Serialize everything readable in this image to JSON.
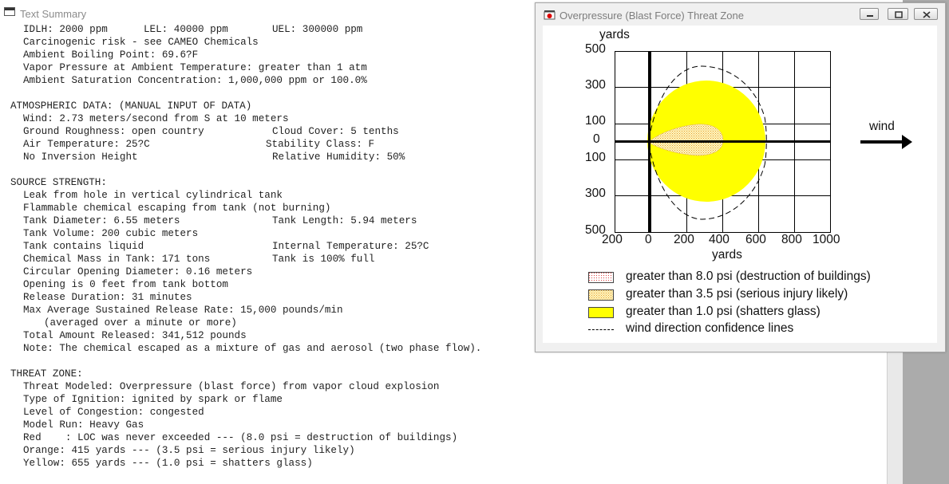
{
  "text_window": {
    "title": "Text Summary",
    "chemical": {
      "idlh": "IDLH: 2000 ppm",
      "lel": "LEL: 40000 ppm",
      "uel": "UEL: 300000 ppm",
      "carcinogenic": "Carcinogenic risk - see CAMEO Chemicals",
      "boiling_point": "Ambient Boiling Point: 69.6?F",
      "vapor_pressure": "Vapor Pressure at Ambient Temperature: greater than 1 atm",
      "saturation": "Ambient Saturation Concentration: 1,000,000 ppm or 100.0%"
    },
    "atmospheric": {
      "heading": "ATMOSPHERIC DATA: (MANUAL INPUT OF DATA)",
      "wind": "Wind: 2.73 meters/second from S at 10 meters",
      "roughness": "Ground Roughness: open country",
      "cloud_cover": "Cloud Cover: 5 tenths",
      "air_temp": "Air Temperature: 25?C",
      "stability": "Stability Class: F",
      "inversion": "No Inversion Height",
      "humidity": "Relative Humidity: 50%"
    },
    "source": {
      "heading": "SOURCE STRENGTH:",
      "leak": "Leak from hole in vertical cylindrical tank",
      "flammable": "Flammable chemical escaping from tank (not burning)",
      "tank_diameter": "Tank Diameter: 6.55 meters",
      "tank_length": "Tank Length: 5.94 meters",
      "tank_volume": "Tank Volume: 200 cubic meters",
      "tank_contains": "Tank contains liquid",
      "internal_temp": "Internal Temperature: 25?C",
      "chemical_mass": "Chemical Mass in Tank: 171 tons",
      "tank_full": "Tank is 100% full",
      "opening_diameter": "Circular Opening Diameter: 0.16 meters",
      "opening_height": "Opening is 0 feet from tank bottom",
      "release_duration": "Release Duration: 31 minutes",
      "max_release": "Max Average Sustained Release Rate: 15,000 pounds/min",
      "averaged": "(averaged over a minute or more)",
      "total_released": "Total Amount Released: 341,512 pounds",
      "note": "Note: The chemical escaped as a mixture of gas and aerosol (two phase flow)."
    },
    "threat": {
      "heading": "THREAT ZONE:",
      "modeled": "Threat Modeled: Overpressure (blast force) from vapor cloud explosion",
      "ignition": "Type of Ignition: ignited by spark or flame",
      "congestion": "Level of Congestion: congested",
      "model_run": "Model Run: Heavy Gas",
      "red": "Red    : LOC was never exceeded --- (8.0 psi = destruction of buildings)",
      "orange": "Orange: 415 yards --- (3.5 psi = serious injury likely)",
      "yellow": "Yellow: 655 yards --- (1.0 psi = shatters glass)"
    }
  },
  "zone_window": {
    "title": "Overpressure (Blast Force) Threat Zone",
    "buttons": {
      "minimize": "minimize",
      "maximize": "maximize",
      "close": "close"
    },
    "plot": {
      "y_unit": "yards",
      "x_unit": "yards",
      "wind_label": "wind",
      "y_ticks": [
        "500",
        "300",
        "100",
        "0",
        "100",
        "300",
        "500"
      ],
      "x_ticks": [
        "200",
        "0",
        "200",
        "400",
        "600",
        "800",
        "1000"
      ]
    },
    "legend": [
      {
        "label": "greater than 8.0 psi (destruction of buildings)",
        "color": "#ff0000"
      },
      {
        "label": "greater than 3.5 psi (serious injury likely)",
        "color": "#ffa500"
      },
      {
        "label": "greater than 1.0 psi (shatters glass)",
        "color": "#ffff00"
      },
      {
        "label": "wind direction confidence lines",
        "color": "#000000"
      }
    ]
  }
}
